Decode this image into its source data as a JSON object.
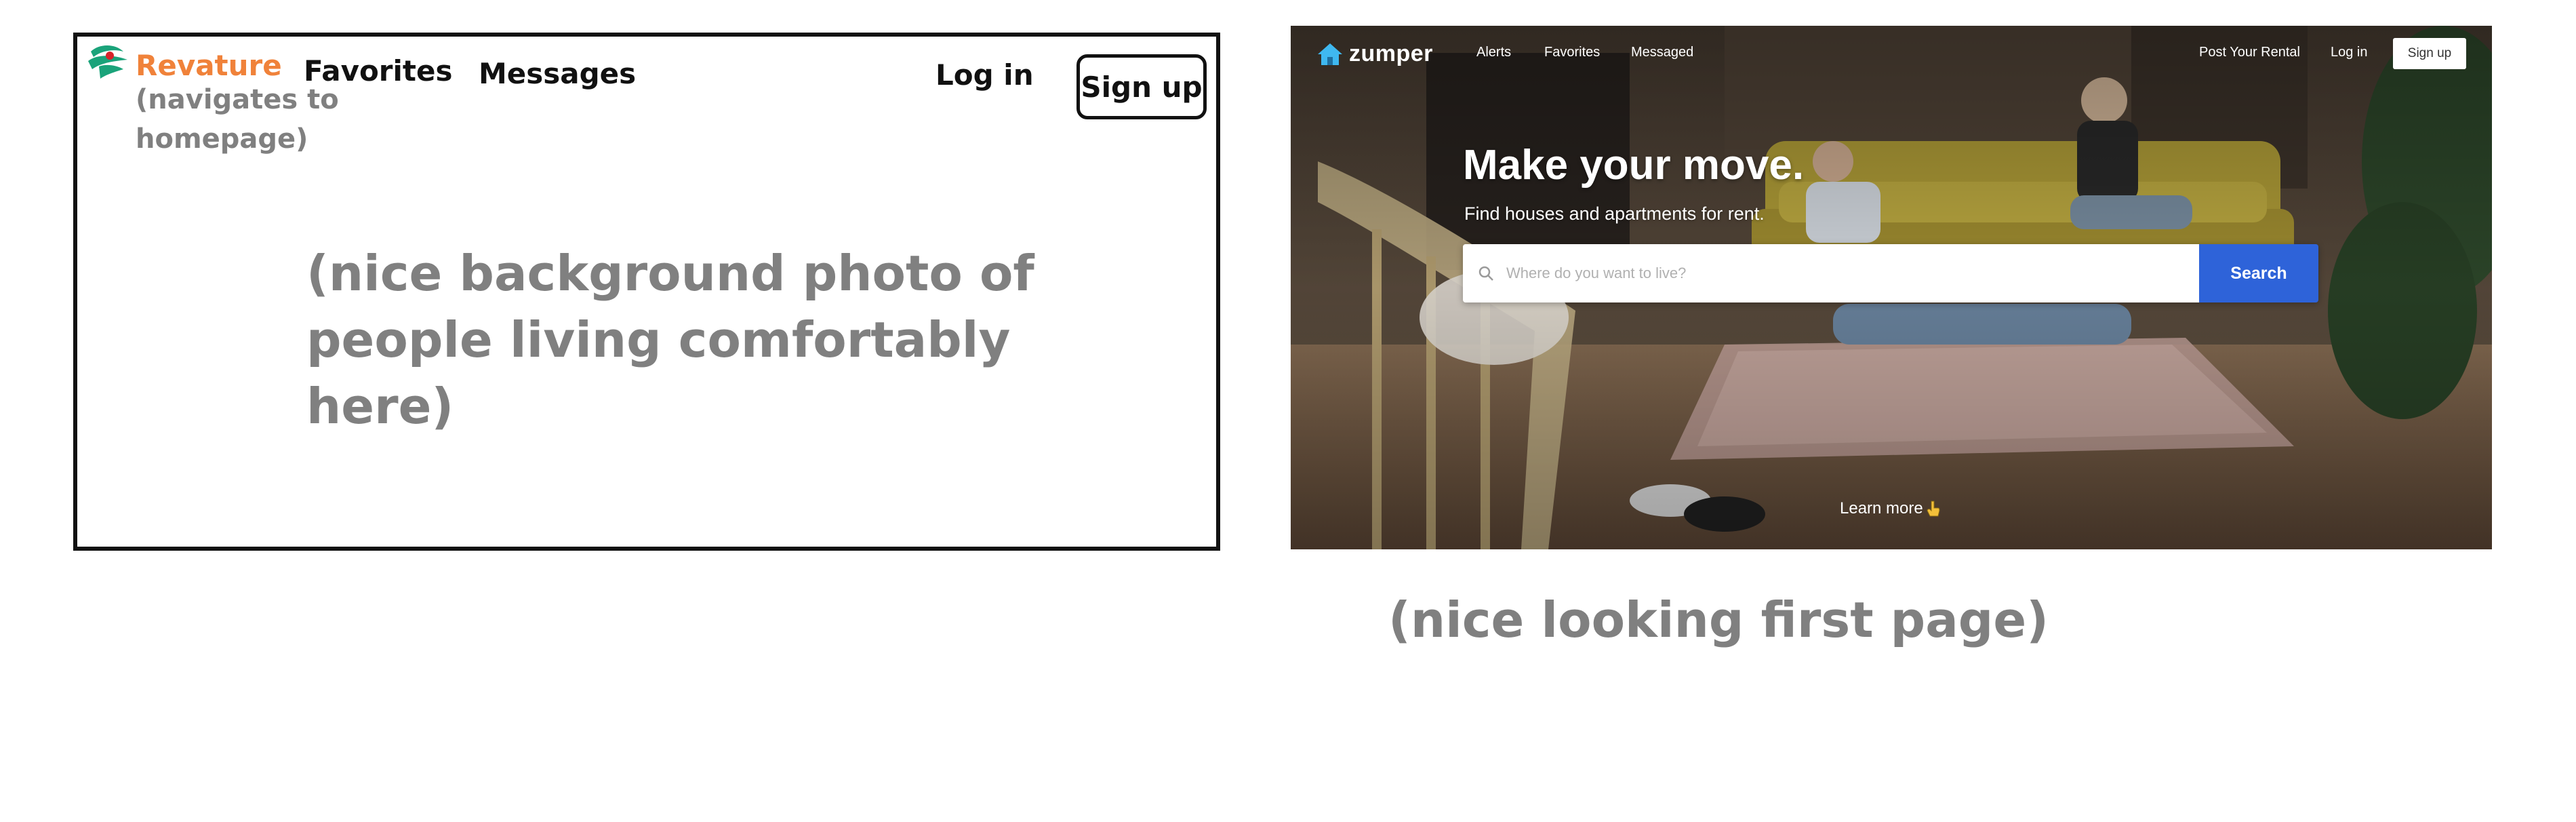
{
  "wireframe": {
    "brand": "Revature",
    "brand_note": "(navigates to homepage)",
    "nav": {
      "favorites": "Favorites",
      "messages": "Messages",
      "login": "Log in",
      "signup": "Sign up"
    },
    "background_note": "(nice background photo of people living comfortably here)"
  },
  "reference": {
    "logo": "zumper",
    "nav": {
      "alerts": "Alerts",
      "favorites": "Favorites",
      "messaged": "Messaged",
      "post_rental": "Post Your Rental",
      "login": "Log in",
      "signup": "Sign up"
    },
    "hero_title": "Make your move.",
    "hero_subtitle": "Find houses and apartments for rent.",
    "search": {
      "placeholder": "Where do you want to live?",
      "button": "Search"
    },
    "learn_more": "Learn more",
    "accent_color": "#2e63d9",
    "logo_color": "#3fb8f0"
  },
  "caption": "(nice looking first page)"
}
